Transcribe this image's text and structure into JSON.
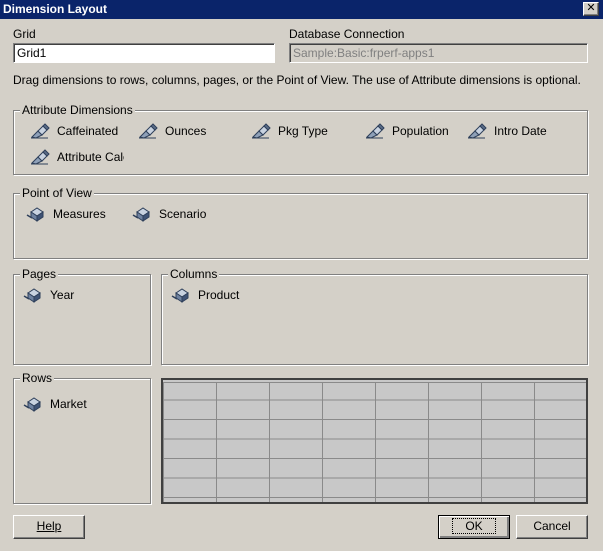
{
  "window": {
    "title": "Dimension Layout"
  },
  "grid": {
    "label": "Grid",
    "value": "Grid1"
  },
  "database": {
    "label": "Database Connection",
    "value": "Sample:Basic:frperf-apps1"
  },
  "instructions": "Drag dimensions to rows, columns, pages, or the Point of View. The use of Attribute dimensions is optional.",
  "attribute_dimensions": {
    "title": "Attribute Dimensions",
    "items": [
      "Caffeinated",
      "Ounces",
      "Pkg Type",
      "Population",
      "Intro Date",
      "Attribute Calcu"
    ]
  },
  "point_of_view": {
    "title": "Point of View",
    "items": [
      "Measures",
      "Scenario"
    ]
  },
  "pages": {
    "title": "Pages",
    "items": [
      "Year"
    ]
  },
  "columns": {
    "title": "Columns",
    "items": [
      "Product"
    ]
  },
  "rows": {
    "title": "Rows",
    "items": [
      "Market"
    ]
  },
  "buttons": {
    "help": "Help",
    "ok": "OK",
    "cancel": "Cancel"
  },
  "colors": {
    "titlebar": "#0a246a",
    "face": "#d4d0c8",
    "grid": "#c8c8c8"
  }
}
